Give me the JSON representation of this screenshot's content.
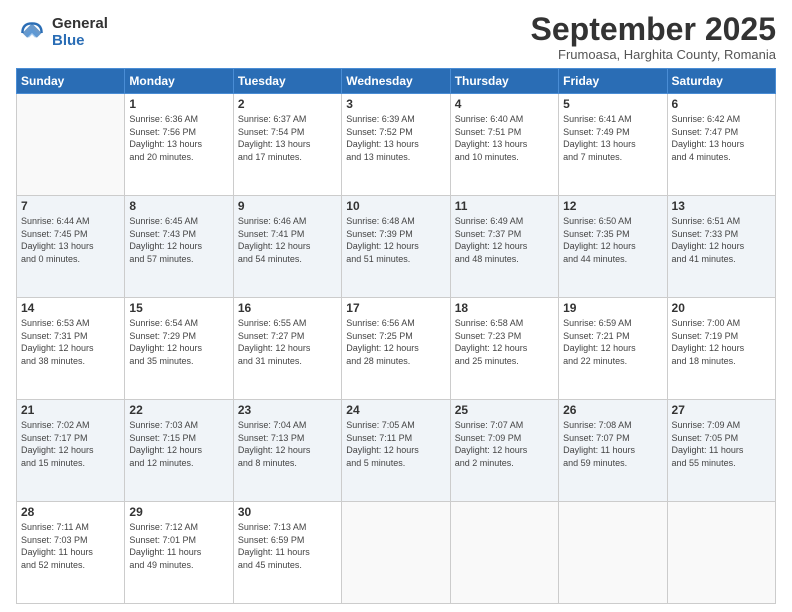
{
  "logo": {
    "general": "General",
    "blue": "Blue"
  },
  "title": "September 2025",
  "subtitle": "Frumoasa, Harghita County, Romania",
  "days": [
    "Sunday",
    "Monday",
    "Tuesday",
    "Wednesday",
    "Thursday",
    "Friday",
    "Saturday"
  ],
  "weeks": [
    [
      {
        "day": "",
        "info": ""
      },
      {
        "day": "1",
        "info": "Sunrise: 6:36 AM\nSunset: 7:56 PM\nDaylight: 13 hours\nand 20 minutes."
      },
      {
        "day": "2",
        "info": "Sunrise: 6:37 AM\nSunset: 7:54 PM\nDaylight: 13 hours\nand 17 minutes."
      },
      {
        "day": "3",
        "info": "Sunrise: 6:39 AM\nSunset: 7:52 PM\nDaylight: 13 hours\nand 13 minutes."
      },
      {
        "day": "4",
        "info": "Sunrise: 6:40 AM\nSunset: 7:51 PM\nDaylight: 13 hours\nand 10 minutes."
      },
      {
        "day": "5",
        "info": "Sunrise: 6:41 AM\nSunset: 7:49 PM\nDaylight: 13 hours\nand 7 minutes."
      },
      {
        "day": "6",
        "info": "Sunrise: 6:42 AM\nSunset: 7:47 PM\nDaylight: 13 hours\nand 4 minutes."
      }
    ],
    [
      {
        "day": "7",
        "info": "Sunrise: 6:44 AM\nSunset: 7:45 PM\nDaylight: 13 hours\nand 0 minutes."
      },
      {
        "day": "8",
        "info": "Sunrise: 6:45 AM\nSunset: 7:43 PM\nDaylight: 12 hours\nand 57 minutes."
      },
      {
        "day": "9",
        "info": "Sunrise: 6:46 AM\nSunset: 7:41 PM\nDaylight: 12 hours\nand 54 minutes."
      },
      {
        "day": "10",
        "info": "Sunrise: 6:48 AM\nSunset: 7:39 PM\nDaylight: 12 hours\nand 51 minutes."
      },
      {
        "day": "11",
        "info": "Sunrise: 6:49 AM\nSunset: 7:37 PM\nDaylight: 12 hours\nand 48 minutes."
      },
      {
        "day": "12",
        "info": "Sunrise: 6:50 AM\nSunset: 7:35 PM\nDaylight: 12 hours\nand 44 minutes."
      },
      {
        "day": "13",
        "info": "Sunrise: 6:51 AM\nSunset: 7:33 PM\nDaylight: 12 hours\nand 41 minutes."
      }
    ],
    [
      {
        "day": "14",
        "info": "Sunrise: 6:53 AM\nSunset: 7:31 PM\nDaylight: 12 hours\nand 38 minutes."
      },
      {
        "day": "15",
        "info": "Sunrise: 6:54 AM\nSunset: 7:29 PM\nDaylight: 12 hours\nand 35 minutes."
      },
      {
        "day": "16",
        "info": "Sunrise: 6:55 AM\nSunset: 7:27 PM\nDaylight: 12 hours\nand 31 minutes."
      },
      {
        "day": "17",
        "info": "Sunrise: 6:56 AM\nSunset: 7:25 PM\nDaylight: 12 hours\nand 28 minutes."
      },
      {
        "day": "18",
        "info": "Sunrise: 6:58 AM\nSunset: 7:23 PM\nDaylight: 12 hours\nand 25 minutes."
      },
      {
        "day": "19",
        "info": "Sunrise: 6:59 AM\nSunset: 7:21 PM\nDaylight: 12 hours\nand 22 minutes."
      },
      {
        "day": "20",
        "info": "Sunrise: 7:00 AM\nSunset: 7:19 PM\nDaylight: 12 hours\nand 18 minutes."
      }
    ],
    [
      {
        "day": "21",
        "info": "Sunrise: 7:02 AM\nSunset: 7:17 PM\nDaylight: 12 hours\nand 15 minutes."
      },
      {
        "day": "22",
        "info": "Sunrise: 7:03 AM\nSunset: 7:15 PM\nDaylight: 12 hours\nand 12 minutes."
      },
      {
        "day": "23",
        "info": "Sunrise: 7:04 AM\nSunset: 7:13 PM\nDaylight: 12 hours\nand 8 minutes."
      },
      {
        "day": "24",
        "info": "Sunrise: 7:05 AM\nSunset: 7:11 PM\nDaylight: 12 hours\nand 5 minutes."
      },
      {
        "day": "25",
        "info": "Sunrise: 7:07 AM\nSunset: 7:09 PM\nDaylight: 12 hours\nand 2 minutes."
      },
      {
        "day": "26",
        "info": "Sunrise: 7:08 AM\nSunset: 7:07 PM\nDaylight: 11 hours\nand 59 minutes."
      },
      {
        "day": "27",
        "info": "Sunrise: 7:09 AM\nSunset: 7:05 PM\nDaylight: 11 hours\nand 55 minutes."
      }
    ],
    [
      {
        "day": "28",
        "info": "Sunrise: 7:11 AM\nSunset: 7:03 PM\nDaylight: 11 hours\nand 52 minutes."
      },
      {
        "day": "29",
        "info": "Sunrise: 7:12 AM\nSunset: 7:01 PM\nDaylight: 11 hours\nand 49 minutes."
      },
      {
        "day": "30",
        "info": "Sunrise: 7:13 AM\nSunset: 6:59 PM\nDaylight: 11 hours\nand 45 minutes."
      },
      {
        "day": "",
        "info": ""
      },
      {
        "day": "",
        "info": ""
      },
      {
        "day": "",
        "info": ""
      },
      {
        "day": "",
        "info": ""
      }
    ]
  ]
}
